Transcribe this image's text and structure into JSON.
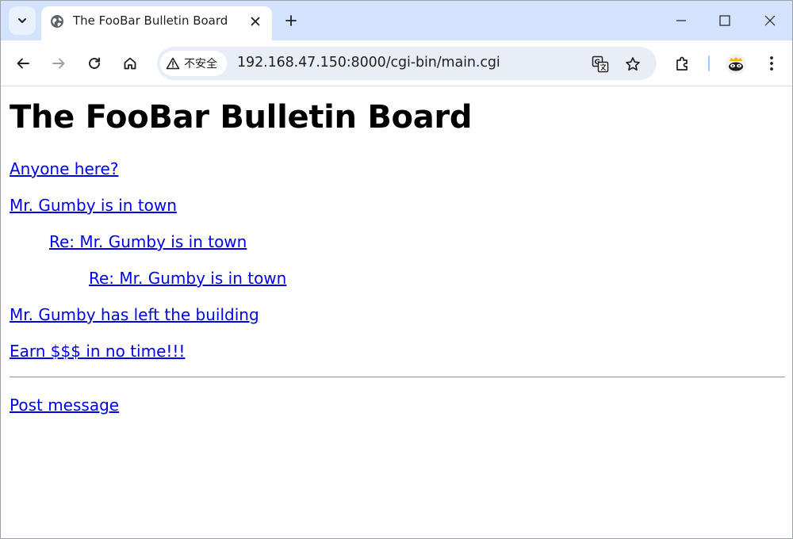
{
  "browser": {
    "tab": {
      "title": "The FooBar Bulletin Board"
    },
    "address_bar": {
      "security_label": "不安全",
      "url": "192.168.47.150:8000/cgi-bin/main.cgi"
    },
    "icons": {
      "tab_search": "chevron-down-icon",
      "favicon": "globe-icon",
      "tab_close": "close-icon",
      "new_tab": "plus-icon",
      "minimize": "minimize-icon",
      "maximize": "maximize-icon",
      "close_window": "close-icon",
      "back": "back-arrow-icon",
      "forward": "forward-arrow-icon",
      "reload": "reload-icon",
      "home": "home-icon",
      "warning": "warning-icon",
      "translate": "translate-icon",
      "bookmark": "star-icon",
      "extensions": "puzzle-icon",
      "menu": "kebab-menu-icon"
    },
    "colors": {
      "tabstrip": "#d3e3fd",
      "omnibox": "#e9eef6",
      "link": "#0000ee"
    }
  },
  "page": {
    "heading": "The FooBar Bulletin Board",
    "messages": [
      {
        "title": "Anyone here?",
        "depth": 0
      },
      {
        "title": "Mr. Gumby is in town",
        "depth": 0
      },
      {
        "title": "Re: Mr. Gumby is in town",
        "depth": 1
      },
      {
        "title": "Re: Mr. Gumby is in town",
        "depth": 2
      },
      {
        "title": "Mr. Gumby has left the building",
        "depth": 0
      },
      {
        "title": "Earn $$$ in no time!!!",
        "depth": 0
      }
    ],
    "post_link": "Post message"
  }
}
